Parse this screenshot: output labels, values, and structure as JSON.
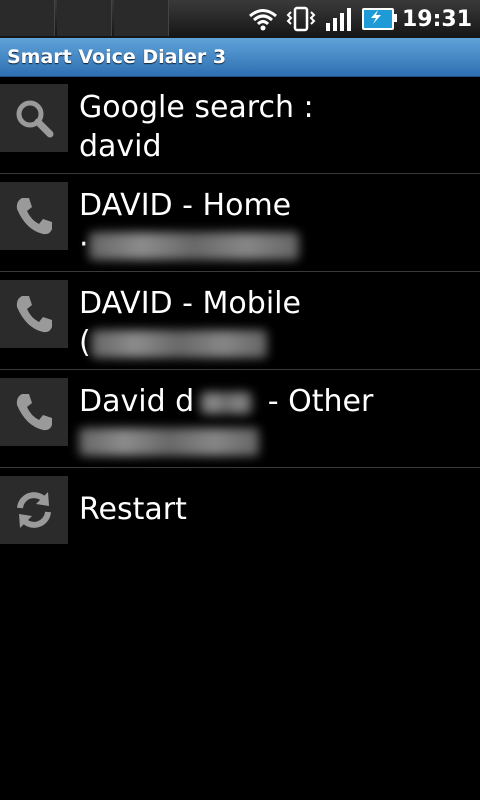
{
  "status_bar": {
    "time": "19:31",
    "icons": [
      "wifi-icon",
      "vibrate-icon",
      "signal-icon",
      "battery-charging-icon"
    ]
  },
  "app": {
    "title": "Smart Voice Dialer 3"
  },
  "list": {
    "items": [
      {
        "icon": "search-icon",
        "line1": "Google search :",
        "line2": "david"
      },
      {
        "icon": "phone-icon",
        "line1": "DAVID - Home",
        "line2_prefix": "·"
      },
      {
        "icon": "phone-icon",
        "line1": "DAVID - Mobile",
        "line2_prefix": "("
      },
      {
        "icon": "phone-icon",
        "line1_start": "David d",
        "line1_end": " - Other",
        "line2_prefix": ""
      },
      {
        "icon": "refresh-icon",
        "line1": "Restart"
      }
    ]
  },
  "colors": {
    "title_bar_top": "#5fa3d8",
    "title_bar_bottom": "#2f6fb3",
    "background": "#000000",
    "icon_box": "#2b2b2b",
    "divider": "#3a3a3a"
  }
}
